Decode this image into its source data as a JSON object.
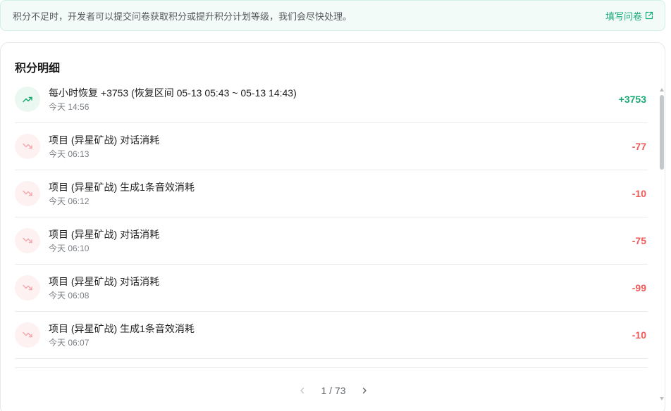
{
  "notice": {
    "text": "积分不足时，开发者可以提交问卷获取积分或提升积分计划等级，我们会尽快处理。",
    "link_label": "填写问卷"
  },
  "card": {
    "title": "积分明细"
  },
  "records": [
    {
      "direction": "up",
      "title": "每小时恢复 +3753 (恢复区间 05-13 05:43 ~ 05-13 14:43)",
      "time": "今天 14:56",
      "amount": "+3753"
    },
    {
      "direction": "down",
      "title": "项目 (异星矿战) 对话消耗",
      "time": "今天 06:13",
      "amount": "-77"
    },
    {
      "direction": "down",
      "title": "项目 (异星矿战) 生成1条音效消耗",
      "time": "今天 06:12",
      "amount": "-10"
    },
    {
      "direction": "down",
      "title": "项目 (异星矿战) 对话消耗",
      "time": "今天 06:10",
      "amount": "-75"
    },
    {
      "direction": "down",
      "title": "项目 (异星矿战) 对话消耗",
      "time": "今天 06:08",
      "amount": "-99"
    },
    {
      "direction": "down",
      "title": "项目 (异星矿战) 生成1条音效消耗",
      "time": "今天 06:07",
      "amount": "-10"
    }
  ],
  "pagination": {
    "text": "1 / 73"
  },
  "colors": {
    "positive": "#19a974",
    "negative": "#ef5a5a",
    "accent": "#18a97a"
  },
  "icons": {
    "up": "trending-up-icon",
    "down": "trending-down-icon",
    "link": "external-link-icon",
    "prev": "chevron-left-icon",
    "next": "chevron-right-icon"
  }
}
